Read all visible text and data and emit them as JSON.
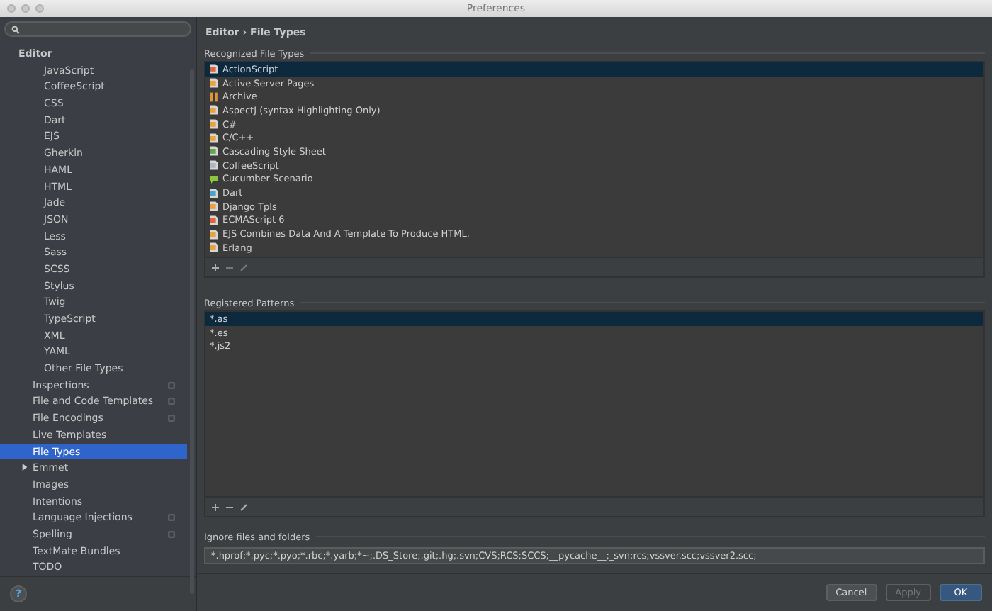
{
  "window": {
    "title": "Preferences"
  },
  "sidebar": {
    "items": [
      {
        "label": "Editor",
        "children": [
          {
            "children": [
              {
                "label": "JavaScript"
              },
              {
                "label": "CoffeeScript"
              },
              {
                "label": "CSS"
              },
              {
                "label": "Dart"
              },
              {
                "label": "EJS"
              },
              {
                "label": "Gherkin"
              },
              {
                "label": "HAML"
              },
              {
                "label": "HTML"
              },
              {
                "label": "Jade"
              },
              {
                "label": "JSON"
              },
              {
                "label": "Less"
              },
              {
                "label": "Sass"
              },
              {
                "label": "SCSS"
              },
              {
                "label": "Stylus"
              },
              {
                "label": "Twig"
              },
              {
                "label": "TypeScript"
              },
              {
                "label": "XML"
              },
              {
                "label": "YAML"
              },
              {
                "label": "Other File Types"
              }
            ]
          },
          {
            "label": "Inspections",
            "selected": false,
            "project": true
          },
          {
            "label": "File and Code Templates",
            "selected": false,
            "project": true
          },
          {
            "label": "File Encodings",
            "selected": false,
            "project": true
          },
          {
            "label": "Live Templates",
            "selected": false,
            "project": false
          },
          {
            "label": "File Types",
            "selected": true,
            "project": false
          },
          {
            "label": "Emmet",
            "selected": false,
            "project": false,
            "expanded": false
          },
          {
            "label": "Images",
            "selected": false,
            "project": false
          },
          {
            "label": "Intentions",
            "selected": false,
            "project": false
          },
          {
            "label": "Language Injections",
            "selected": false,
            "project": true
          },
          {
            "label": "Spelling",
            "selected": false,
            "project": true
          },
          {
            "label": "TextMate Bundles",
            "selected": false,
            "project": false
          },
          {
            "label": "TODO",
            "selected": false,
            "project": false
          }
        ]
      }
    ],
    "help": "?"
  },
  "breadcrumb": "Editor › File Types",
  "recognized": {
    "label": "Recognized File Types",
    "items": [
      {
        "label": "ActionScript",
        "kind": "file",
        "color": "#e0643c",
        "selected": true
      },
      {
        "label": "Active Server Pages",
        "kind": "file",
        "color": "#e8a33c",
        "selected": false
      },
      {
        "label": "Archive",
        "kind": "archive",
        "color": "#d9963a",
        "selected": false
      },
      {
        "label": "AspectJ (syntax Highlighting Only)",
        "kind": "file",
        "color": "#e8a33c",
        "selected": false
      },
      {
        "label": "C#",
        "kind": "file",
        "color": "#e8a33c",
        "selected": false
      },
      {
        "label": "C/C++",
        "kind": "file",
        "color": "#e8a33c",
        "selected": false
      },
      {
        "label": "Cascading Style Sheet",
        "kind": "file",
        "color": "#5fa84a",
        "selected": false
      },
      {
        "label": "CoffeeScript",
        "kind": "file",
        "color": "#a9b7c6",
        "selected": false
      },
      {
        "label": "Cucumber Scenario",
        "kind": "bubble",
        "color": "#8cc63f",
        "selected": false
      },
      {
        "label": "Dart",
        "kind": "file",
        "color": "#4aa3c9",
        "selected": false
      },
      {
        "label": "Django Tpls",
        "kind": "file",
        "color": "#e8a33c",
        "selected": false
      },
      {
        "label": "ECMAScript 6",
        "kind": "file",
        "color": "#e0643c",
        "selected": false
      },
      {
        "label": "EJS Combines Data And A Template To Produce HTML.",
        "kind": "file",
        "color": "#e8a33c",
        "selected": false
      },
      {
        "label": "Erlang",
        "kind": "file",
        "color": "#e8a33c",
        "selected": false
      }
    ]
  },
  "patterns": {
    "label": "Registered Patterns",
    "items": [
      {
        "label": "*.as",
        "selected": true
      },
      {
        "label": "*.es",
        "selected": false
      },
      {
        "label": "*.js2",
        "selected": false
      }
    ]
  },
  "ignore": {
    "label": "Ignore files and folders",
    "value": "*.hprof;*.pyc;*.pyo;*.rbc;*.yarb;*~;.DS_Store;.git;.hg;.svn;CVS;RCS;SCCS;__pycache__;_svn;rcs;vssver.scc;vssver2.scc;"
  },
  "buttons": [
    {
      "label": "Cancel",
      "kind": "normal",
      "disabled": false
    },
    {
      "label": "Apply",
      "kind": "normal",
      "disabled": true
    },
    {
      "label": "OK",
      "kind": "default",
      "disabled": false
    }
  ]
}
